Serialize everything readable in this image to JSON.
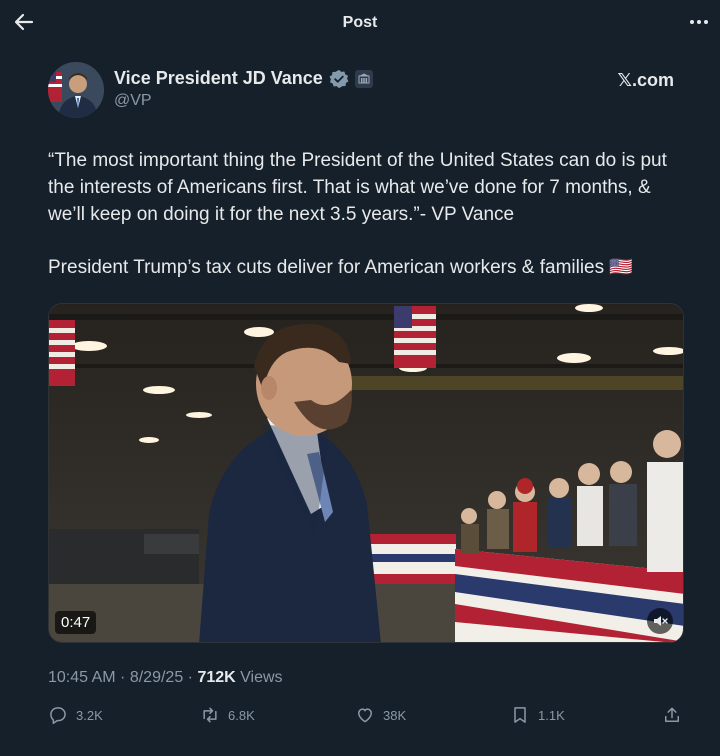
{
  "header": {
    "title": "Post",
    "back_icon": "arrow-left-icon",
    "more_icon": "more-horizontal-icon"
  },
  "author": {
    "name": "Vice President JD Vance",
    "handle": "@VP",
    "verified_icon": "verified-badge-icon",
    "affiliation_icon": "government-seal-icon",
    "source": "𝕏.com"
  },
  "post": {
    "paragraph1": "“The most important thing the President of the United States can do is put the interests of Americans first. That is what we’ve done for 7 months, & we’ll keep on doing it for the next 3.5 years.”- VP Vance",
    "paragraph2": "President Trump’s tax cuts deliver for American workers & families 🇺🇸"
  },
  "media": {
    "duration": "0:47",
    "mute_icon": "speaker-muted-icon"
  },
  "meta": {
    "time": "10:45 AM",
    "separator": " · ",
    "date": "8/29/25",
    "views_count": "712K",
    "views_label": " Views"
  },
  "actions": {
    "replies": "3.2K",
    "reposts": "6.8K",
    "likes": "38K",
    "bookmarks": "1.1K"
  },
  "colors": {
    "background": "#15202b",
    "text": "#e7e9ea",
    "muted": "#8b98a5",
    "verified": "#829aab"
  }
}
